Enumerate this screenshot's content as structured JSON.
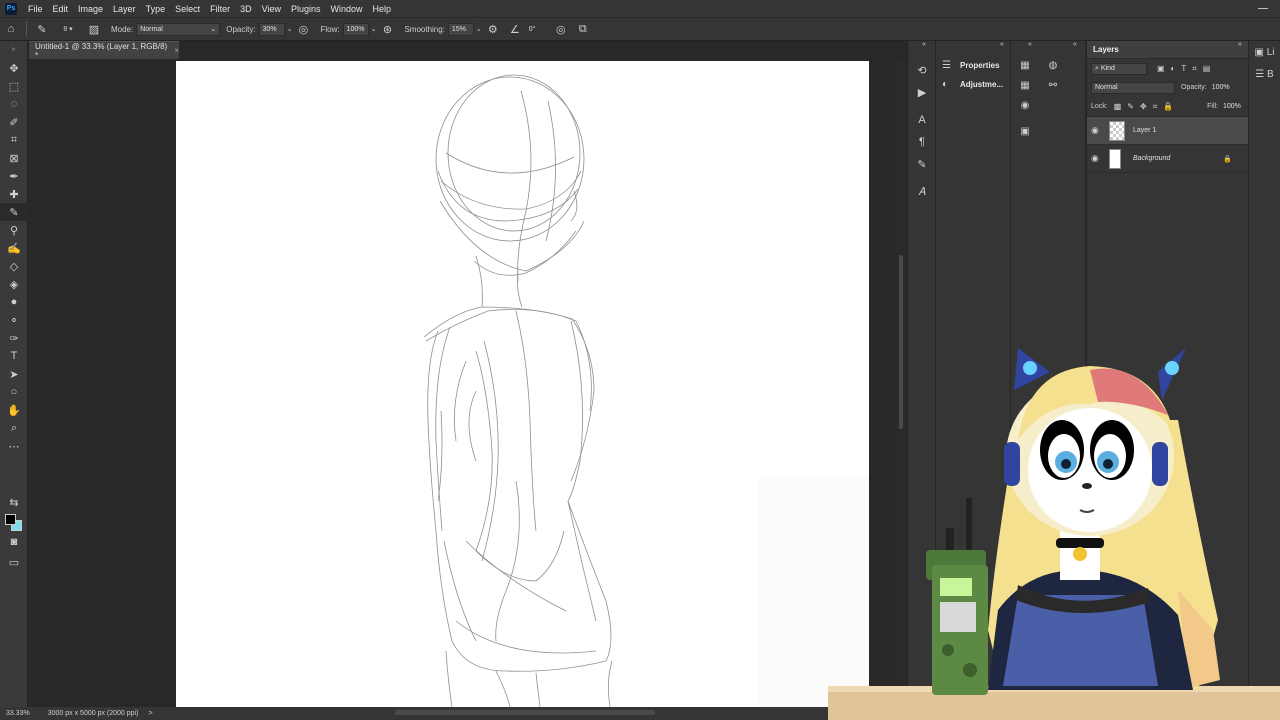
{
  "app": {
    "logo_text": "Ps"
  },
  "menu": [
    "File",
    "Edit",
    "Image",
    "Layer",
    "Type",
    "Select",
    "Filter",
    "3D",
    "View",
    "Plugins",
    "Window",
    "Help"
  ],
  "options": {
    "mode_label": "Mode:",
    "mode_value": "Normal",
    "opacity_label": "Opacity:",
    "opacity_value": "30%",
    "flow_label": "Flow:",
    "flow_value": "100%",
    "smoothing_label": "Smoothing:",
    "smoothing_value": "15%",
    "angle_value": "0°",
    "brush_size": "8"
  },
  "document": {
    "tab_title": "Untitled-1 @ 33.3% (Layer 1, RGB/8) *",
    "close_glyph": "×"
  },
  "status": {
    "zoom": "33.33%",
    "doc_info": "3000 px x 5000 px (2000 ppi)",
    "arrow": ">"
  },
  "dock": {
    "properties": "Properties",
    "adjustments": "Adjustme..."
  },
  "layers_panel": {
    "title": "Layers",
    "filter_kind": "Kind",
    "blend_mode": "Normal",
    "opacity_label": "Opacity:",
    "opacity_value": "100%",
    "lock_label": "Lock:",
    "fill_label": "Fill:",
    "fill_value": "100%",
    "layers": [
      {
        "name": "Layer 1",
        "selected": true
      },
      {
        "name": "Background",
        "selected": false,
        "locked": true
      }
    ]
  },
  "far_right": {
    "label1": "Li",
    "label2": "B"
  },
  "colors": {
    "foreground": "#000000",
    "background": "#7fdcef",
    "ui_dark": "#353535",
    "canvas": "#ffffff"
  },
  "icons": [
    "home-icon",
    "brush-icon",
    "move-icon",
    "marquee-icon",
    "lasso-icon",
    "crop-icon",
    "eyedropper-icon",
    "eraser-icon",
    "text-icon",
    "hand-icon",
    "zoom-icon",
    "eye-icon",
    "lock-icon",
    "play-icon"
  ]
}
